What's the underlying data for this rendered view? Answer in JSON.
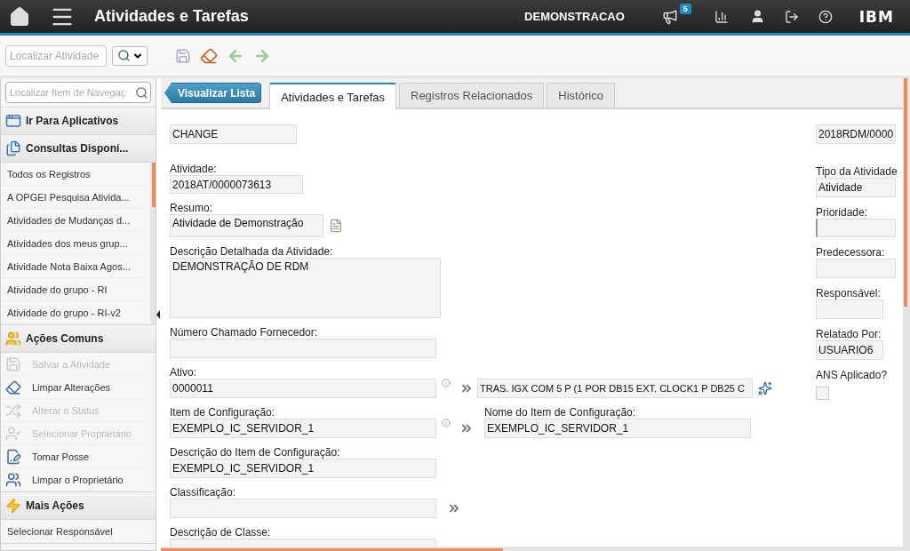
{
  "header": {
    "title": "Atividades e Tarefas",
    "user": "DEMONSTRACAO",
    "notification_count": "5",
    "brand": "IBM"
  },
  "toolbar": {
    "search": {
      "placeholder": "Localizar Atividade"
    }
  },
  "sidebar": {
    "search": {
      "placeholder": "Localizar Item de Navegaç"
    },
    "sections": [
      {
        "title": "Ir Para Aplicativos"
      },
      {
        "title": "Consultas Disponí...",
        "items": [
          {
            "label": "Todos os Registros",
            "disabled": false
          },
          {
            "label": "A OPGEI Pesquisa Ativida...",
            "disabled": false
          },
          {
            "label": "Atividades de Mudanças d...",
            "disabled": false
          },
          {
            "label": "Atividades dos meus grup...",
            "disabled": false
          },
          {
            "label": "Atividade Nota Baixa Agos...",
            "disabled": false
          },
          {
            "label": "Atividade do grupo - RI",
            "disabled": false
          },
          {
            "label": "Atividade do grupo - RI-v2",
            "disabled": false
          }
        ]
      },
      {
        "title": "Ações Comuns",
        "items": [
          {
            "label": "Salvar a Atividade",
            "disabled": true
          },
          {
            "label": "Limpar Alterações",
            "disabled": false
          },
          {
            "label": "Alterar o Status",
            "disabled": true
          },
          {
            "label": "Selecionar Proprietário",
            "disabled": true
          },
          {
            "label": "Tomar Posse",
            "disabled": false
          },
          {
            "label": "Limpar o Proprietário",
            "disabled": false
          }
        ]
      },
      {
        "title": "Mais Ações",
        "items": [
          {
            "label": "Selecionar Responsável",
            "disabled": false
          }
        ]
      }
    ]
  },
  "back_button": "Visualizar Lista",
  "tabs": [
    {
      "label": "Atividades e Tarefas",
      "selected": true
    },
    {
      "label": "Registros Relacionados",
      "selected": false
    },
    {
      "label": "Histórico",
      "selected": false
    }
  ],
  "form": {
    "left": [
      {
        "value": "CHANGE"
      },
      {
        "label": "Atividade:",
        "value": "2018AT/0000073613"
      },
      {
        "label": "Resumo:",
        "value": "Atividade de Demonstração",
        "long_text_button": true
      },
      {
        "label": "Descrição Detalhada da Atividade:",
        "value": "DEMONSTRAÇÃO DE RDM"
      },
      {
        "label": "Número Chamado Fornecedor:"
      },
      {
        "label": "Ativo:",
        "value": "0000011",
        "info": true,
        "lookup": true,
        "side": {
          "value": "TRAS. IGX COM 5 P (1 POR DB15 EXT. CLOCK1 P DB25 C",
          "detail_button": true
        }
      },
      {
        "label": "Item de Configuração:",
        "value": "EXEMPLO_IC_SERVIDOR_1",
        "info": true,
        "lookup": true,
        "side": {
          "label": "Nome do Item de Configuração:",
          "value": "EXEMPLO_IC_SERVIDOR_1"
        }
      },
      {
        "label": "Descrição do Item de Configuração:",
        "value": "EXEMPLO_IC_SERVIDOR_1"
      },
      {
        "label": "Classificação:",
        "lookup": true
      },
      {
        "label": "Descrição de Classe:"
      }
    ],
    "right": [
      {
        "kind": "text",
        "value": "2018RDM/0000"
      },
      {
        "kind": "text",
        "label": "Tipo da Atividade",
        "value": "Atividade"
      },
      {
        "kind": "select",
        "label": "Prioridade:"
      },
      {
        "kind": "text",
        "label": "Predecessora:"
      },
      {
        "kind": "text",
        "label": "Responsável:"
      },
      {
        "kind": "text",
        "label": "Relatado Por:",
        "value": "USUARIO6"
      },
      {
        "kind": "checkbox",
        "label": "ANS Aplicado?",
        "checked": false
      }
    ]
  }
}
